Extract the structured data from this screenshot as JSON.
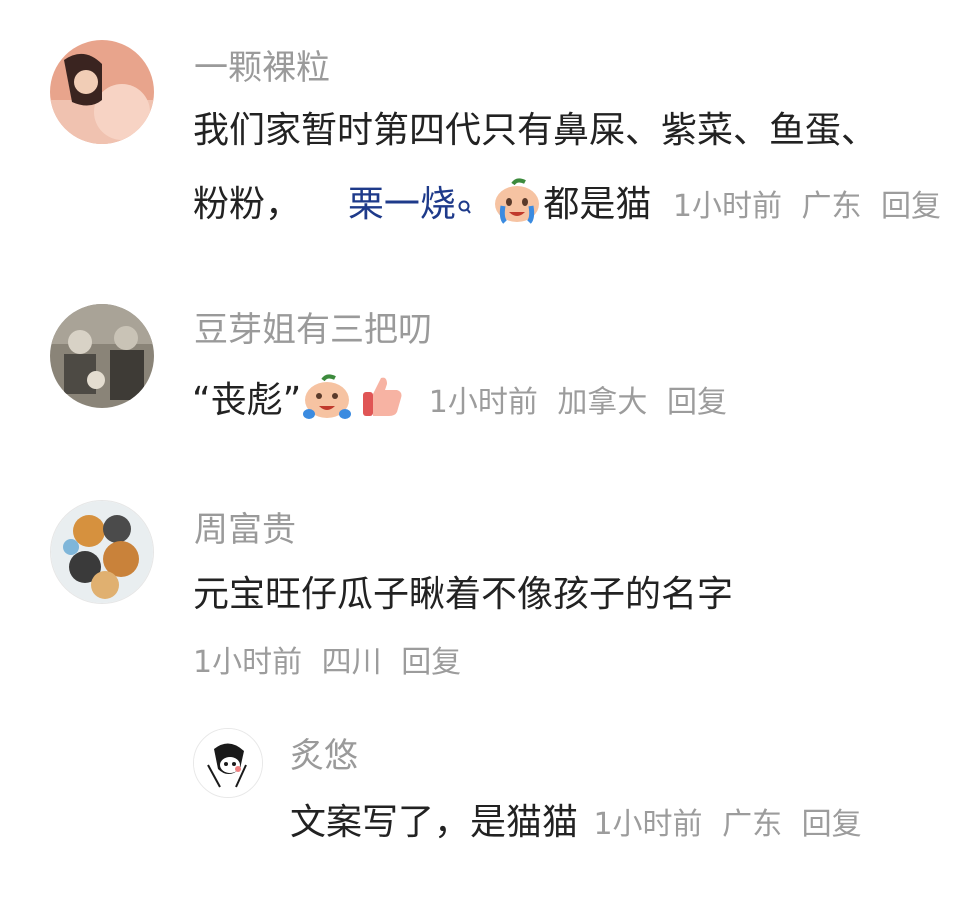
{
  "comments": [
    {
      "username": "一颗裸粒",
      "text_line1": "我们家暂时第四代只有鼻屎、紫菜、鱼蛋、",
      "text_line2_prefix": "粉粉，",
      "mention": "栗一烧",
      "text_line2_suffix": "都是猫",
      "time": "1小时前",
      "location": "广东",
      "reply": "回复"
    },
    {
      "username": "豆芽姐有三把叨",
      "text": "“丧彪”",
      "time": "1小时前",
      "location": "加拿大",
      "reply": "回复"
    },
    {
      "username": "周富贵",
      "text": "元宝旺仔瓜子瞅着不像孩子的名字",
      "time": "1小时前",
      "location": "四川",
      "reply": "回复"
    },
    {
      "username": "炙悠",
      "text": "文案写了，是猫猫",
      "time": "1小时前",
      "location": "广东",
      "reply": "回复"
    }
  ],
  "icons": {
    "mention_icon": "search-icon",
    "emoji_cry": "crying-face-emoji",
    "emoji_thumb": "thumbs-up-emoji"
  },
  "colors": {
    "username": "#9a9a9a",
    "text": "#222222",
    "meta": "#9c9c9c",
    "mention": "#1e3a8a"
  }
}
